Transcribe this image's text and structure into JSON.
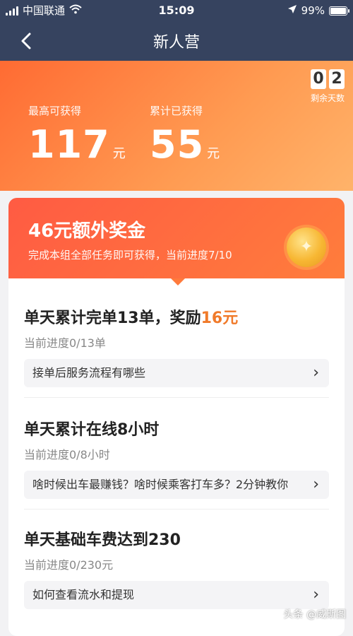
{
  "status_bar": {
    "carrier": "中国联通",
    "time": "15:09",
    "battery": "99%"
  },
  "nav": {
    "title": "新人营"
  },
  "hero": {
    "days_digits": [
      "0",
      "2"
    ],
    "days_label": "剩余天数",
    "max_label": "最高可获得",
    "max_value": "117",
    "max_unit": "元",
    "earned_label": "累计已获得",
    "earned_value": "55",
    "earned_unit": "元"
  },
  "bonus": {
    "title": "46元额外奖金",
    "subtitle": "完成本组全部任务即可获得，当前进度7/10"
  },
  "tasks": [
    {
      "title": "单天累计完单13单，奖励",
      "reward": "16元",
      "progress": "当前进度0/13单",
      "link": "接单后服务流程有哪些"
    },
    {
      "title": "单天累计在线8小时",
      "reward": "",
      "progress": "当前进度0/8小时",
      "link": "啥时候出车最赚钱？啥时候乘客打车多？2分钟教你"
    },
    {
      "title": "单天基础车费达到230",
      "reward": "",
      "progress": "当前进度0/230元",
      "link": "如何查看流水和提现"
    }
  ],
  "watermark": "头条 @威斯图"
}
